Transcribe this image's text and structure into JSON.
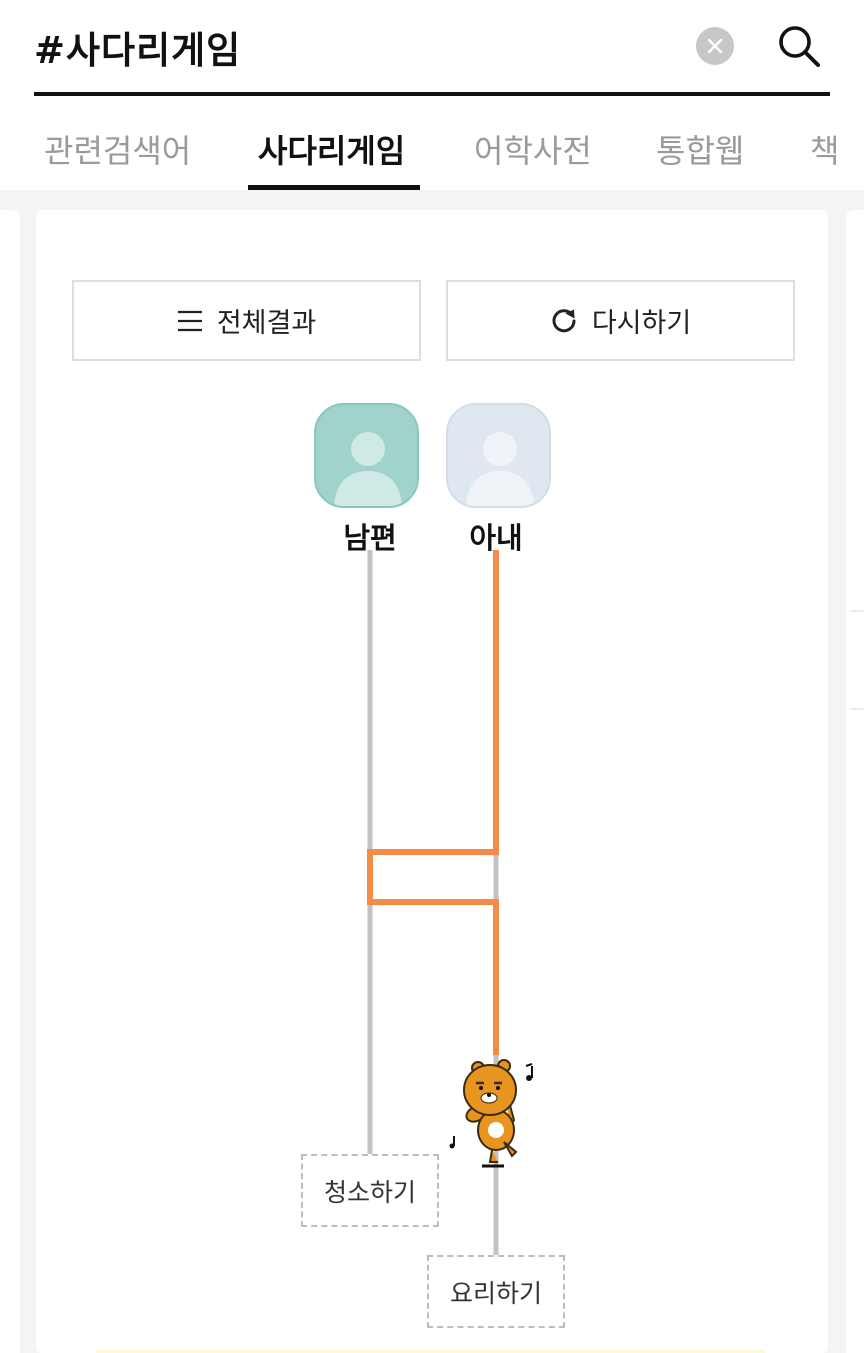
{
  "search": {
    "query": "#사다리게임"
  },
  "tabs": [
    {
      "label": "관련검색어",
      "active": false
    },
    {
      "label": "사다리게임",
      "active": true
    },
    {
      "label": "어학사전",
      "active": false
    },
    {
      "label": "통합웹",
      "active": false
    },
    {
      "label": "책",
      "active": false
    }
  ],
  "buttons": {
    "all_results": "전체결과",
    "retry": "다시하기"
  },
  "players": [
    {
      "name": "남편",
      "avatar_color": "#9fd3cb"
    },
    {
      "name": "아내",
      "avatar_color": "#dfe8f1"
    }
  ],
  "results": {
    "left": "청소하기",
    "right": "요리하기"
  },
  "colors": {
    "path": "#f28c48",
    "rail": "#c2c2c2",
    "accent": "#111111"
  },
  "icons": {
    "clear": "close-icon",
    "search": "search-icon",
    "list": "menu-icon",
    "retry": "refresh-icon",
    "mascot": "bear-character"
  }
}
